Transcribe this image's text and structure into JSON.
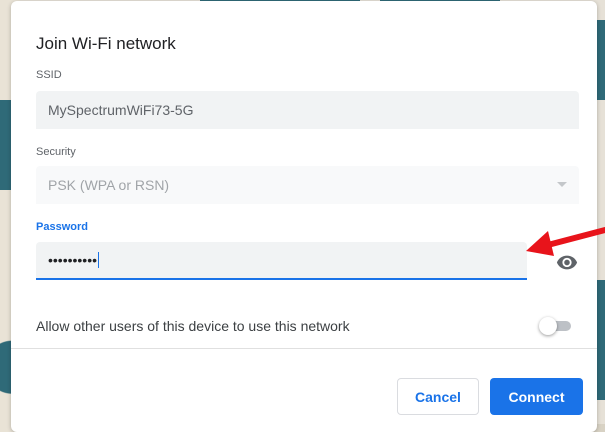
{
  "dialog": {
    "title": "Join Wi-Fi network",
    "ssid": {
      "label": "SSID",
      "value": "MySpectrumWiFi73-5G"
    },
    "security": {
      "label": "Security",
      "value": "PSK (WPA or RSN)"
    },
    "password": {
      "label": "Password",
      "value": "••••••••••"
    },
    "share_toggle": {
      "label": "Allow other users of this device to use this network",
      "enabled": false
    },
    "buttons": {
      "cancel": "Cancel",
      "connect": "Connect"
    }
  },
  "icons": {
    "show_password": "eye-icon",
    "security_dropdown": "chevron-down-icon",
    "annotation": "red-arrow-icon"
  },
  "colors": {
    "accent": "#1a73e8",
    "annotation": "#e8141b",
    "field_background": "#f1f3f4"
  }
}
